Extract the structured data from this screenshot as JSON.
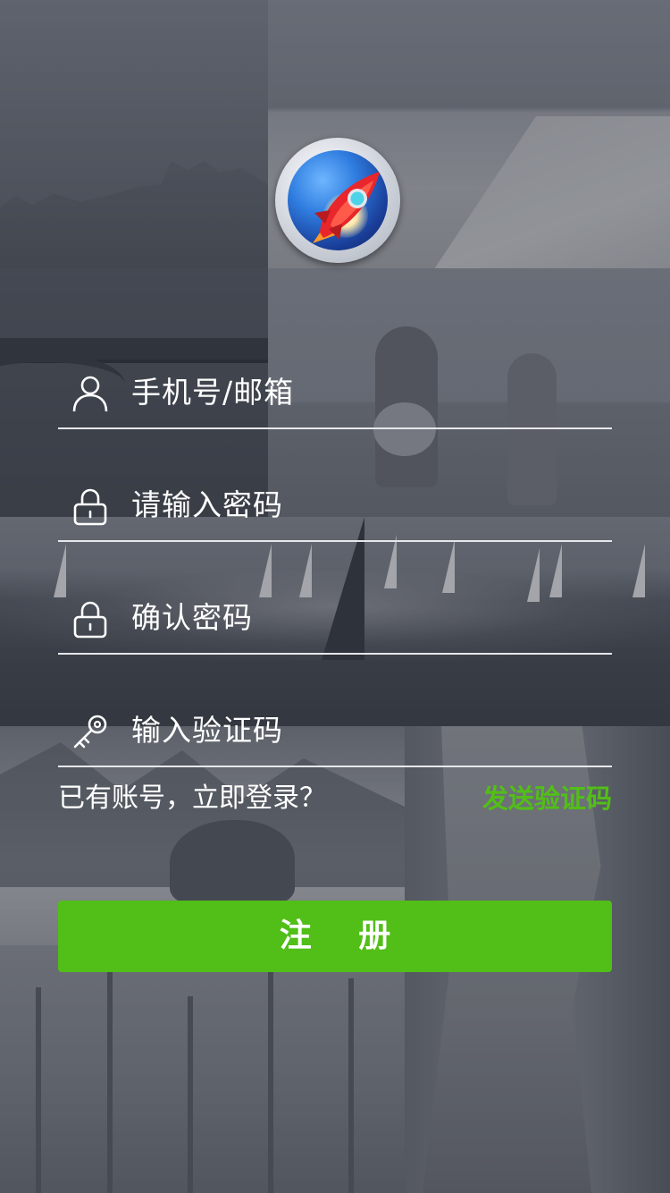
{
  "form": {
    "phone_placeholder": "手机号/邮箱",
    "password_placeholder": "请输入密码",
    "confirm_placeholder": "确认密码",
    "code_placeholder": "输入验证码"
  },
  "links": {
    "login": "已有账号，立即登录？",
    "send_code": "发送验证码"
  },
  "buttons": {
    "register": "注 册"
  },
  "icons": {
    "logo": "rocket-logo-icon",
    "phone": "user-icon",
    "password": "lock-icon",
    "confirm": "lock-icon",
    "code": "key-icon"
  },
  "colors": {
    "accent": "#52be18",
    "text": "#ffffff",
    "field_line": "#e6e7ea"
  }
}
